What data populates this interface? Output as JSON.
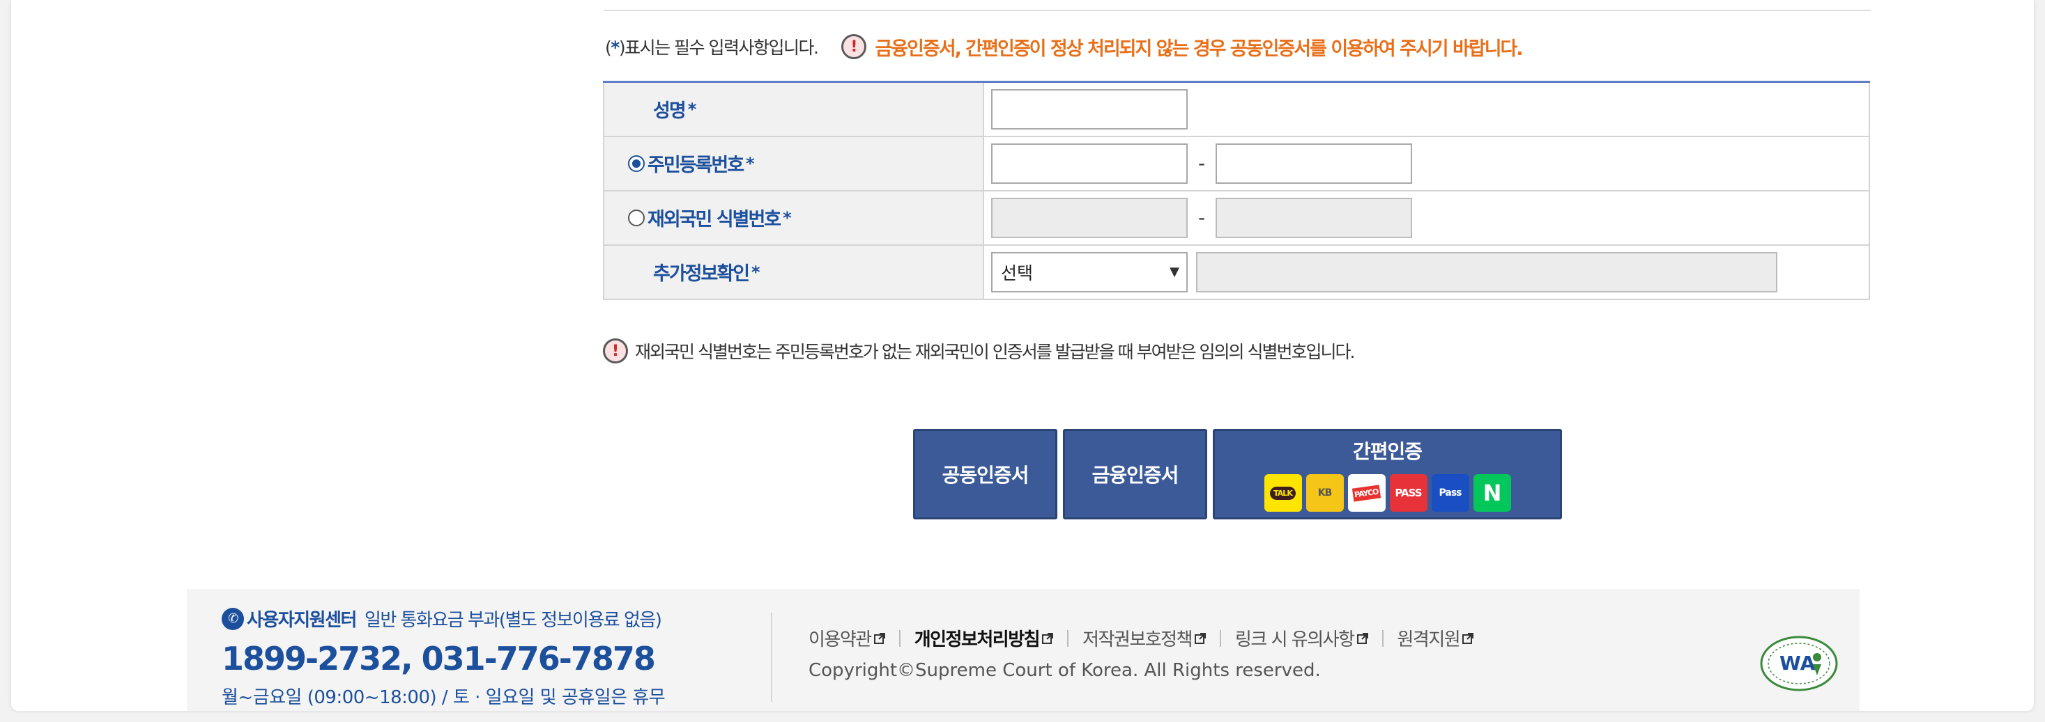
{
  "notice": {
    "required_open": "(",
    "required_star": "*",
    "required_text": ")표시는 필수 입력사항입니다.",
    "warning_icon": "!",
    "warning_text": "금융인증서, 간편인증이 정상 처리되지 않는 경우 공동인증서를 이용하여 주시기 바랍니다."
  },
  "form": {
    "name_label": "성명",
    "resident_label": "주민등록번호",
    "foreigner_label": "재외국민 식별번호",
    "extra_label": "추가정보확인",
    "star": "*",
    "dash": "-",
    "select_value": "선택",
    "select_arrow": "▼",
    "resident_selected": true
  },
  "info": {
    "icon": "!",
    "text": "재외국민 식별번호는 주민등록번호가 없는 재외국민이 인증서를 발급받을 때 부여받은 임의의 식별번호입니다."
  },
  "buttons": {
    "joint_cert": "공동인증서",
    "financial_cert": "금융인증서",
    "simple_auth": "간편인증",
    "logos": {
      "kakao": "TALK",
      "kb": "KB",
      "payco": "PAYCO",
      "pass": "PASS",
      "samsung": "Pass",
      "naver": "N"
    }
  },
  "footer": {
    "phone_icon": "✆",
    "support_title": "사용자지원센터",
    "support_sub": "일반 통화요금 부과(별도 정보이용료 없음)",
    "phone": "1899-2732, 031-776-7878",
    "hours": "월~금요일 (09:00~18:00) / 토 · 일요일 및 공휴일은 휴무",
    "links": [
      "이용약관",
      "개인정보처리방침",
      "저작권보호정책",
      "링크 시 유의사항",
      "원격지원"
    ],
    "copyright": "Copyright©Supreme Court of Korea. All Rights reserved.",
    "wa_mark": "WA"
  },
  "colors": {
    "primary": "#1c4f9c",
    "button": "#3b5a97",
    "warning": "#e8701a"
  }
}
